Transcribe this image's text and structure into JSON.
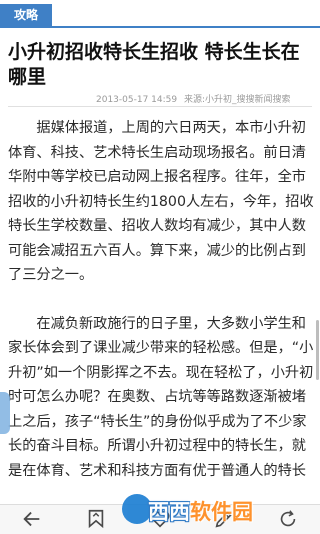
{
  "header": {
    "tag": "攻略"
  },
  "article": {
    "title": "小升初招收特长生招收 特长生长在哪里",
    "date": "2013-05-17 14:59",
    "source": "来源:小升初_搜搜新闻搜索",
    "paragraphs": [
      "据媒体报道，上周的六日两天，本市小升初体育、科技、艺术特长生启动现场报名。前日清华附中等学校已启动网上报名程序。往年，全市招收的小升初特长生约1800人左右，今年，招收特长生学校数量、招收人数均有减少，其中人数可能会减招五六百人。算下来，减少的比例占到了三分之一。",
      "在减负新政施行的日子里，大多数小学生和家长体会到了课业减少带来的轻松感。但是，“小升初”如一个阴影挥之不去。现在轻松了，小升初时可怎么办呢？在奥数、占坑等等路数逐渐被堵上之后，孩子“特长生”的身份似乎成为了不少家长的奋斗目标。所谓小升初过程中的特长生，就是在体育、艺术和科技方面有优于普通人的特长"
    ]
  },
  "toolbar": {
    "icons": [
      "back-arrow-icon",
      "bookmark-icon",
      "heart-icon",
      "edit-icon",
      "refresh-icon"
    ]
  },
  "watermark": {
    "text_part1": "西西",
    "text_part2": "软件园"
  },
  "colors": {
    "accent": "#3f80c6",
    "meta": "#9a9a9a",
    "icon": "#4a4a4a"
  }
}
